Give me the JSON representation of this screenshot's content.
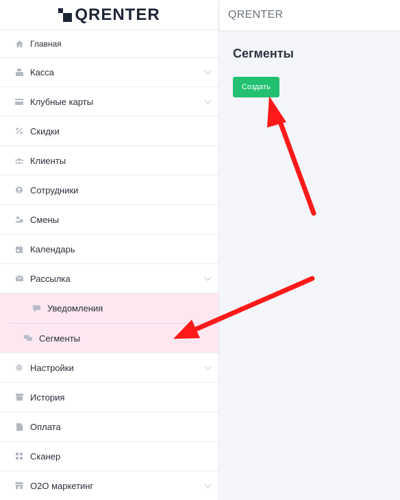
{
  "app": {
    "logo_text": "QRENTER",
    "topbar_title": "QRENTER"
  },
  "sidebar": {
    "items": [
      {
        "label": "Главная",
        "icon": "home-icon"
      },
      {
        "label": "Касса",
        "icon": "cash-register-icon",
        "expandable": true
      },
      {
        "label": "Клубные карты",
        "icon": "credit-card-icon",
        "expandable": true
      },
      {
        "label": "Скидки",
        "icon": "percent-icon"
      },
      {
        "label": "Клиенты",
        "icon": "users-icon"
      },
      {
        "label": "Сотрудники",
        "icon": "user-circle-icon"
      },
      {
        "label": "Смены",
        "icon": "user-clock-icon"
      },
      {
        "label": "Календарь",
        "icon": "calendar-icon"
      },
      {
        "label": "Рассылка",
        "icon": "envelope-icon",
        "expandable": true,
        "expanded": true
      },
      {
        "label": "Настройки",
        "icon": "gear-icon",
        "expandable": true
      },
      {
        "label": "История",
        "icon": "archive-icon"
      },
      {
        "label": "Оплата",
        "icon": "file-icon"
      },
      {
        "label": "Сканер",
        "icon": "grid-icon"
      },
      {
        "label": "O2O маркетинг",
        "icon": "store-icon",
        "expandable": true
      }
    ],
    "sub_items": [
      {
        "label": "Уведомления",
        "icon": "comment-icon"
      },
      {
        "label": "Сегменты",
        "icon": "comments-icon",
        "active": true
      }
    ]
  },
  "main": {
    "title": "Сегменты",
    "create_button": "Создать"
  },
  "colors": {
    "accent": "#22c070",
    "submenu_bg": "#fde8f2",
    "arrow": "#ff1a1a",
    "text_dark": "#2b3140"
  }
}
